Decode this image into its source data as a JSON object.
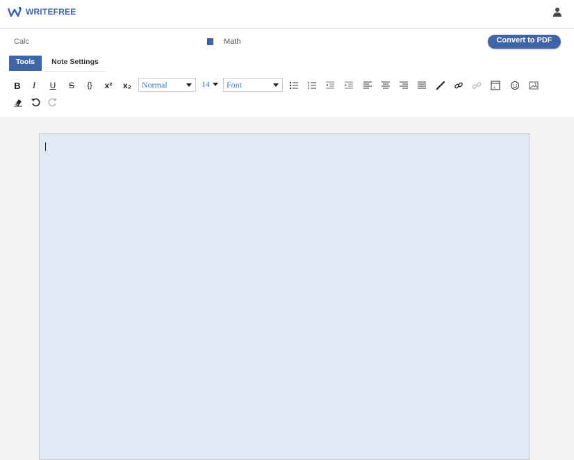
{
  "app": {
    "name": "WRITEFREE",
    "brand_color": "#3f64a8"
  },
  "header": {
    "user_icon": "user-icon"
  },
  "note": {
    "left_label": "Calc",
    "subject_icon": "book-icon",
    "subject": "Math"
  },
  "actions": {
    "convert_label": "Convert to PDF"
  },
  "tabs": [
    {
      "label": "Tools",
      "active": true
    },
    {
      "label": "Note Settings",
      "active": false
    }
  ],
  "toolbar": {
    "bold": "B",
    "italic": "I",
    "underline": "U",
    "strike": "S",
    "code": "{}",
    "superscript": "x²",
    "subscript": "x₂",
    "paragraph_style": "Normal",
    "font_size": "14",
    "font_family": "Font",
    "icons": [
      "bullet-list-icon",
      "numbered-list-icon",
      "outdent-icon",
      "indent-icon",
      "align-left-icon",
      "align-center-icon",
      "align-right-icon",
      "justify-icon",
      "pen-icon",
      "link-icon",
      "unlink-icon",
      "formula-icon",
      "emoji-icon",
      "image-icon",
      "eraser-icon",
      "undo-icon",
      "redo-icon"
    ]
  },
  "editor": {
    "background": "#e1eaf4"
  }
}
